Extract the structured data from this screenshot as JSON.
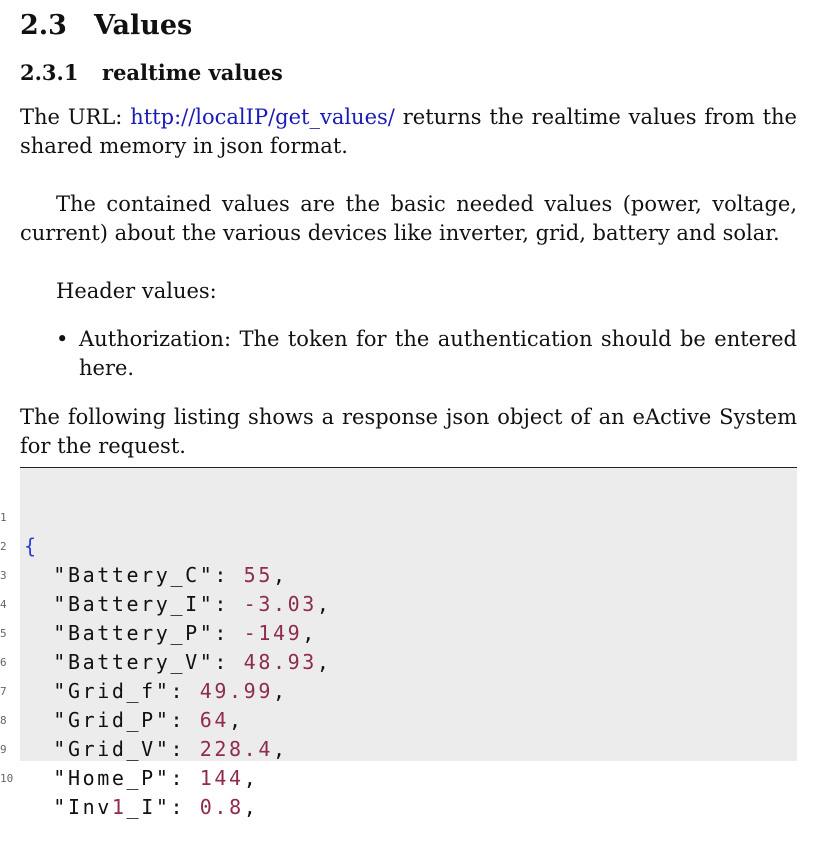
{
  "section": {
    "number": "2.3",
    "title": "Values"
  },
  "subsection": {
    "number": "2.3.1",
    "title": "realtime values"
  },
  "paragraph1": {
    "before_link": "The URL: ",
    "link": "http://localIP/get_values/",
    "after_link": " returns the realtime values from the shared memory in json format."
  },
  "paragraph2": "The contained values are the basic needed values (power, voltage, current) about the various devices like inverter, grid, battery and solar.",
  "paragraph3": "Header values:",
  "bullets": [
    {
      "text": "Authorization: The token for the authentication should be entered here."
    }
  ],
  "paragraph4": "The following listing shows a response json object of an eActive System for the request.",
  "listing": {
    "open_brace": "{",
    "entries": [
      {
        "key": "Battery_C",
        "value": "55"
      },
      {
        "key": "Battery_I",
        "value": "-3.03"
      },
      {
        "key": "Battery_P",
        "value": "-149"
      },
      {
        "key": "Battery_V",
        "value": "48.93"
      },
      {
        "key": "Grid_f",
        "value": "49.99"
      },
      {
        "key": "Grid_P",
        "value": "64"
      },
      {
        "key": "Grid_V",
        "value": "228.4"
      },
      {
        "key": "Home_P",
        "value": "144"
      },
      {
        "key_before": "Inv",
        "key_highlight": "1",
        "key_after": "_I",
        "value": "0.8"
      }
    ],
    "line_numbers": [
      "1",
      "2",
      "3",
      "4",
      "5",
      "6",
      "7",
      "8",
      "9",
      "10"
    ]
  }
}
